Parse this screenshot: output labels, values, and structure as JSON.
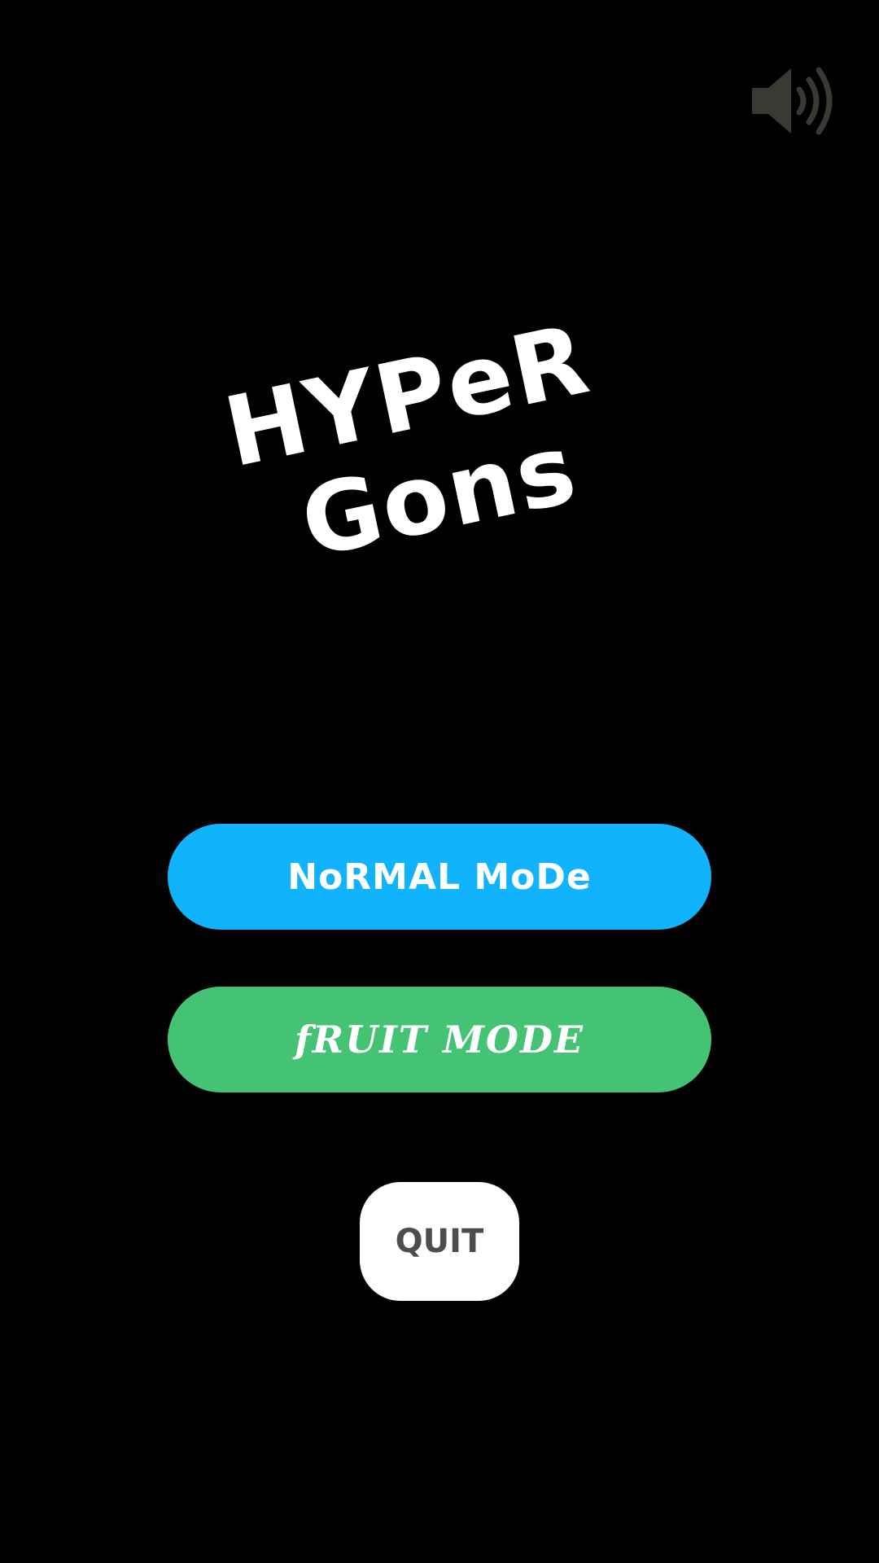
{
  "sound": {
    "icon": "speaker-volume-icon",
    "color": "#3a3a34"
  },
  "title": {
    "line1": "HYPeR",
    "line2": "Gons"
  },
  "menu": {
    "normal_mode": {
      "label": "NoRMAL MoDe",
      "color": "#12b3fd"
    },
    "fruit_mode": {
      "label": "fRUIT MODE",
      "color": "#43c373"
    },
    "quit": {
      "label": "QUIT",
      "background": "#ffffff",
      "text_color": "#4d4d4d"
    }
  }
}
